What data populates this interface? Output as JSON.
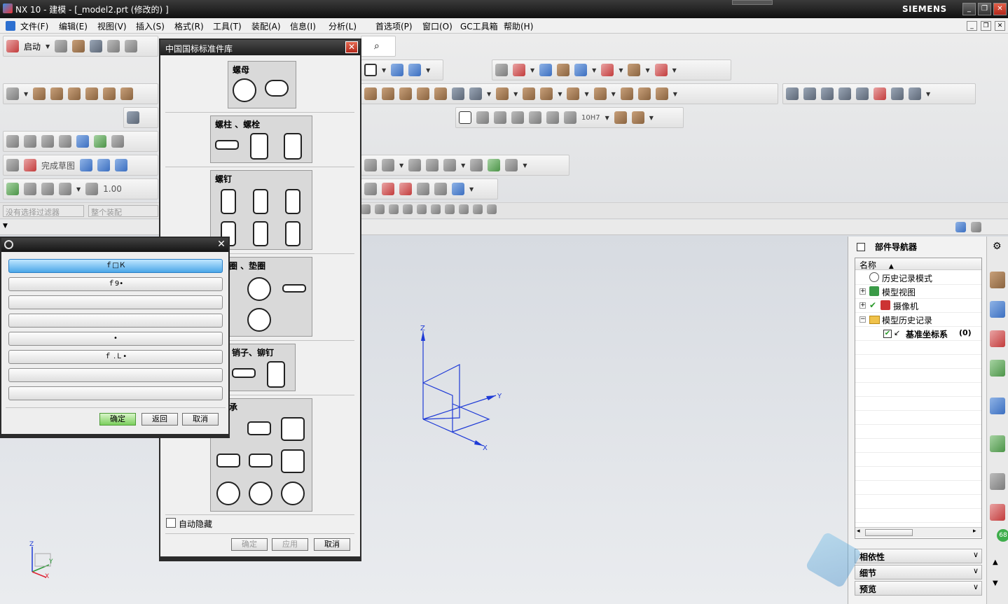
{
  "window": {
    "title": "NX 10 - 建模 - [_model2.prt  (修改的) ]",
    "brand": "SIEMENS",
    "min": "_",
    "restore": "❐",
    "close": "✕"
  },
  "menubar": {
    "items": [
      "文件(F)",
      "编辑(E)",
      "视图(V)",
      "插入(S)",
      "格式(R)",
      "工具(T)",
      "装配(A)",
      "信息(I)",
      "分析(L)",
      "首选项(P)",
      "窗口(O)",
      "GC工具箱",
      "帮助(H)"
    ]
  },
  "toolbar": {
    "start_label": "启动",
    "finish_sketch": "完成草图",
    "scale_value": "1.00",
    "fit_label": "10H7"
  },
  "filterbar": {
    "filter": "没有选择过滤器",
    "scope": "整个装配"
  },
  "std_library": {
    "title": "中国国标标准件库",
    "groups": [
      {
        "title": "螺母"
      },
      {
        "title": "螺柱 、螺栓"
      },
      {
        "title": "螺钉"
      },
      {
        "title": "圈 、垫圈"
      },
      {
        "title": "销子、铆钉"
      },
      {
        "title": "承"
      }
    ],
    "auto_hide": "自动隐藏",
    "ok": "确定",
    "apply": "应用",
    "cancel": "取消"
  },
  "popup": {
    "options": [
      "ｆ□Ｋ",
      "ｆ9•",
      "",
      "",
      "•",
      "ｆ .Ｌ•",
      "",
      ""
    ],
    "ok": "确定",
    "back": "返回",
    "cancel": "取消"
  },
  "viewport": {
    "axis_x": "X",
    "axis_y": "Y",
    "axis_z": "Z"
  },
  "part_navigator": {
    "title": "部件导航器",
    "column": "名称",
    "items": [
      "历史记录模式",
      "模型视图",
      "摄像机",
      "模型历史记录",
      "基准坐标系"
    ],
    "datum_count": "(0)",
    "sections": [
      "相依性",
      "细节",
      "预览"
    ]
  },
  "rightbar": {
    "badge": "68"
  },
  "colors": {
    "axis": "#1e3ad6",
    "titlebar": "#1e1e1e",
    "selected_option": "#4ba7e8"
  }
}
